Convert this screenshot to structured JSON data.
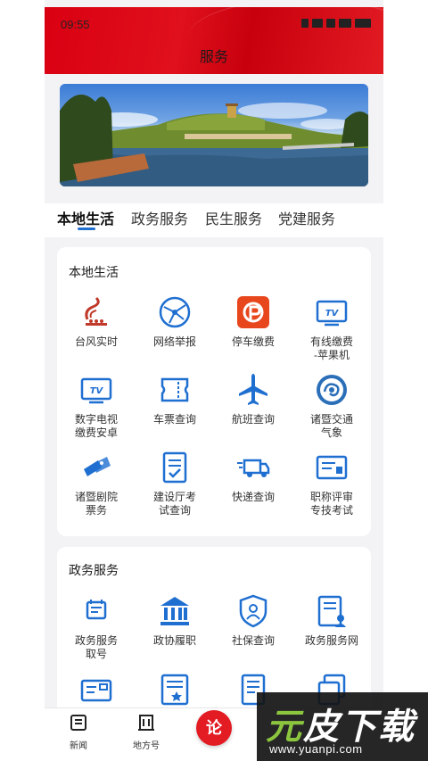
{
  "status_bar": {
    "time": "09:55"
  },
  "header": {
    "title": "服务"
  },
  "tabs": [
    {
      "label": "本地生活"
    },
    {
      "label": "政务服务"
    },
    {
      "label": "民生服务"
    },
    {
      "label": "党建服务"
    }
  ],
  "local_life": {
    "title": "本地生活",
    "items": [
      {
        "label": "台风实时",
        "icon": "typhoon-icon"
      },
      {
        "label": "网络举报",
        "icon": "network-report-icon"
      },
      {
        "label": "停车缴费",
        "icon": "parking-payment-icon"
      },
      {
        "label": "有线缴费\n-苹果机",
        "icon": "tv-payment-icon"
      },
      {
        "label": "数字电视\n缴费安卓",
        "icon": "digital-tv-icon"
      },
      {
        "label": "车票查询",
        "icon": "ticket-icon"
      },
      {
        "label": "航班查询",
        "icon": "airplane-icon"
      },
      {
        "label": "诸暨交通\n气象",
        "icon": "traffic-weather-icon"
      },
      {
        "label": "诸暨剧院\n票务",
        "icon": "theater-ticket-icon"
      },
      {
        "label": "建设厅考\n试查询",
        "icon": "exam-query-icon"
      },
      {
        "label": "快递查询",
        "icon": "delivery-truck-icon"
      },
      {
        "label": "职称评审\n专技考试",
        "icon": "title-review-icon"
      }
    ]
  },
  "gov_services": {
    "title": "政务服务",
    "items": [
      {
        "label": "政务服务\n取号",
        "icon": "queue-number-icon"
      },
      {
        "label": "政协履职",
        "icon": "government-building-icon"
      },
      {
        "label": "社保查询",
        "icon": "social-security-icon"
      },
      {
        "label": "政务服务网",
        "icon": "gov-service-web-icon"
      },
      {
        "label": "",
        "icon": "id-card-icon"
      },
      {
        "label": "",
        "icon": "document-star-icon"
      },
      {
        "label": "",
        "icon": "document-list-icon"
      },
      {
        "label": "",
        "icon": "copy-pages-icon"
      }
    ]
  },
  "bottom_nav": {
    "news": "新闻",
    "local": "地方号",
    "center": "论"
  },
  "watermark": {
    "logo_a": "元",
    "logo_b": "皮下载",
    "url": "www.yuanpi.com"
  },
  "colors": {
    "brand_red": "#e31b23",
    "icon_blue": "#1f6fd1",
    "tab_underline": "#1f6fd1"
  }
}
